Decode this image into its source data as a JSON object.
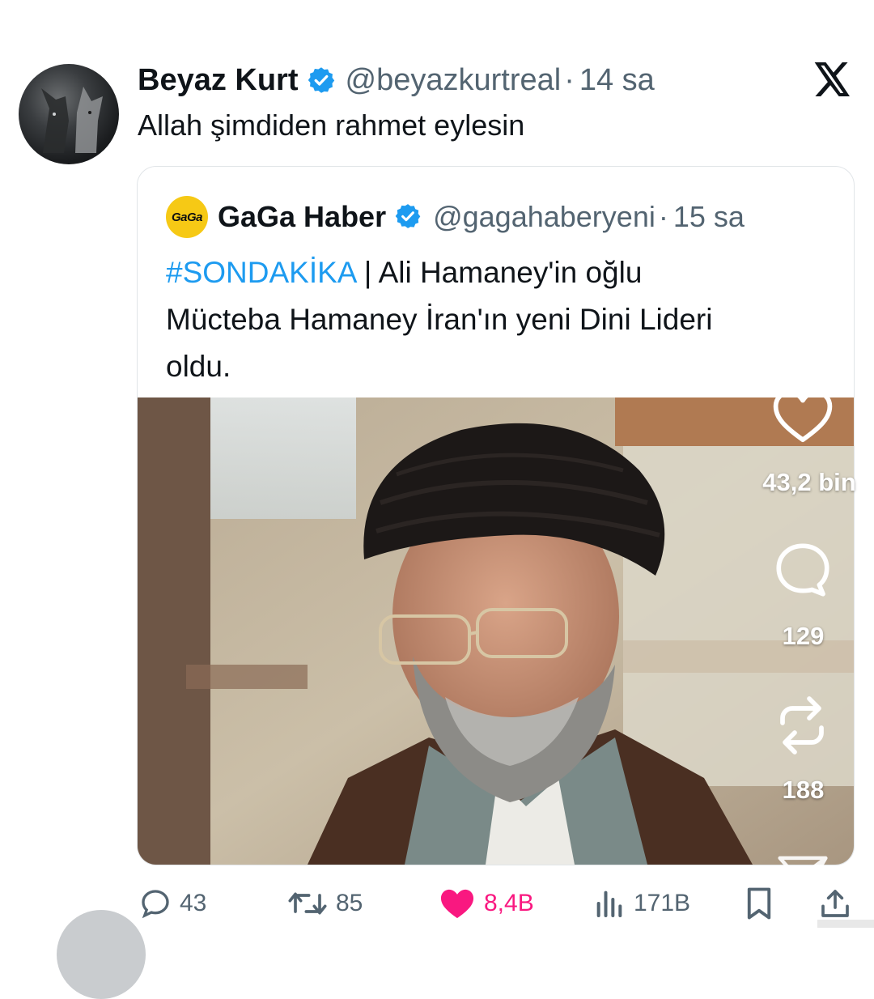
{
  "tweet": {
    "author_name": "Beyaz Kurt",
    "handle": "@beyazkurtreal",
    "separator": "·",
    "time": "14 sa",
    "text": "Allah şimdiden rahmet eylesin"
  },
  "quote": {
    "avatar_text": "GaGa",
    "author_name": "GaGa Haber",
    "handle": "@gagahaberyeni",
    "separator": "·",
    "time": "15 sa",
    "hashtag": "#SONDAKİKA",
    "text_line1": " | Ali Hamaney'in oğlu",
    "text_line2": "Mücteba Hamaney İran'ın yeni Dini Lideri",
    "text_line3": "oldu."
  },
  "side_actions": {
    "likes": "43,2 bin",
    "comments": "129",
    "reposts": "188"
  },
  "action_bar": {
    "replies": "43",
    "reposts": "85",
    "likes": "8,4B",
    "views": "171B"
  },
  "colors": {
    "link": "#1d9bf0",
    "like": "#f91880",
    "muted": "#536471",
    "verified": "#1d9bf0",
    "gaga_yellow": "#f6c915"
  },
  "icons": [
    "verified-badge-icon",
    "x-logo-icon",
    "heart-icon",
    "comment-icon",
    "repost-icon",
    "share-icon",
    "reply-icon",
    "views-icon",
    "bookmark-icon",
    "upload-icon"
  ]
}
